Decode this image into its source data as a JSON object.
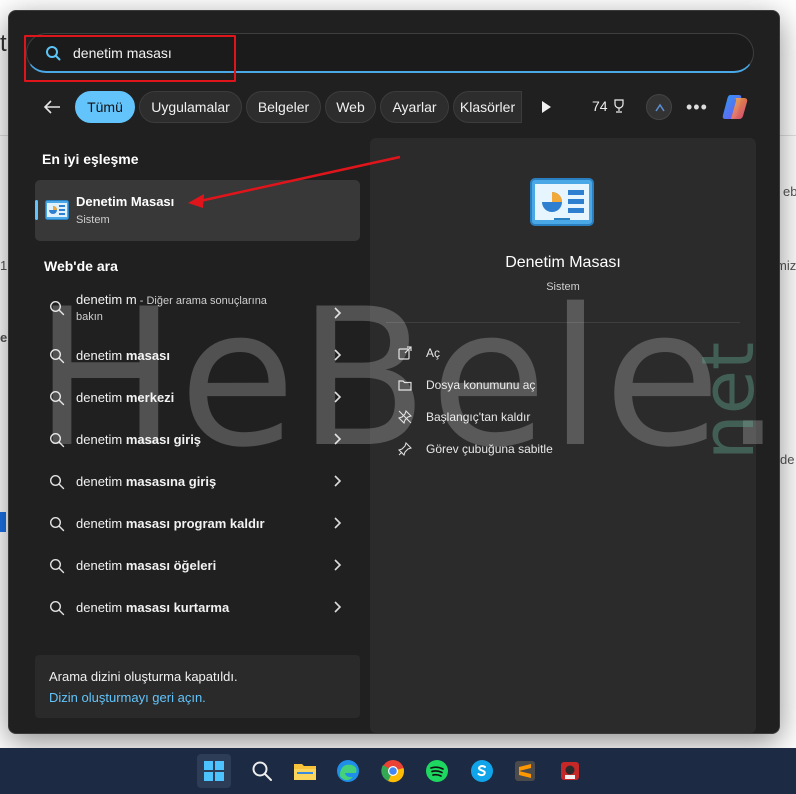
{
  "background_fragments": [
    "t",
    "eb",
    "1",
    "miz",
    "e",
    "de"
  ],
  "search": {
    "value": "denetim masası"
  },
  "filters": {
    "chips": [
      "Tümü",
      "Uygulamalar",
      "Belgeler",
      "Web",
      "Ayarlar",
      "Klasörler"
    ],
    "points": "74"
  },
  "best_match": {
    "heading": "En iyi eşleşme",
    "title": "Denetim Masası",
    "subtitle": "Sistem"
  },
  "web": {
    "heading": "Web'de ara",
    "items": [
      {
        "prefix": "denetim m",
        "bold": "",
        "meta": " - Diğer arama sonuçlarına",
        "meta2": "bakın"
      },
      {
        "prefix": "denetim ",
        "bold": "masası"
      },
      {
        "prefix": "denetim ",
        "bold": "merkezi"
      },
      {
        "prefix": "denetim ",
        "bold": "masası giriş"
      },
      {
        "prefix": "denetim ",
        "bold": "masasına giriş"
      },
      {
        "prefix": "denetim ",
        "bold": "masası program kaldır"
      },
      {
        "prefix": "denetim ",
        "bold": "masası öğeleri"
      },
      {
        "prefix": "denetim ",
        "bold": "masası kurtarma"
      }
    ]
  },
  "notice": {
    "line1": "Arama dizini oluşturma kapatıldı.",
    "line2": "Dizin oluşturmayı geri açın."
  },
  "preview": {
    "title": "Denetim Masası",
    "subtitle": "Sistem",
    "actions": [
      {
        "icon": "open-icon",
        "label": "Aç"
      },
      {
        "icon": "folder-icon",
        "label": "Dosya konumunu aç"
      },
      {
        "icon": "unpin-icon",
        "label": "Başlangıç'tan kaldır"
      },
      {
        "icon": "pin-icon",
        "label": "Görev çubuğuna sabitle"
      }
    ]
  },
  "watermark": {
    "text": "HeBele.",
    "suffix": "net"
  },
  "colors": {
    "accent": "#62c4fb",
    "panel": "#202020",
    "annotation": "#e0151b",
    "taskbar": "#1c2a44"
  },
  "taskbar": {
    "icons": [
      "windows-start-icon",
      "search-icon",
      "file-explorer-icon",
      "edge-icon",
      "chrome-icon",
      "spotify-icon",
      "skype-icon",
      "sublime-text-icon",
      "app-icon"
    ]
  }
}
